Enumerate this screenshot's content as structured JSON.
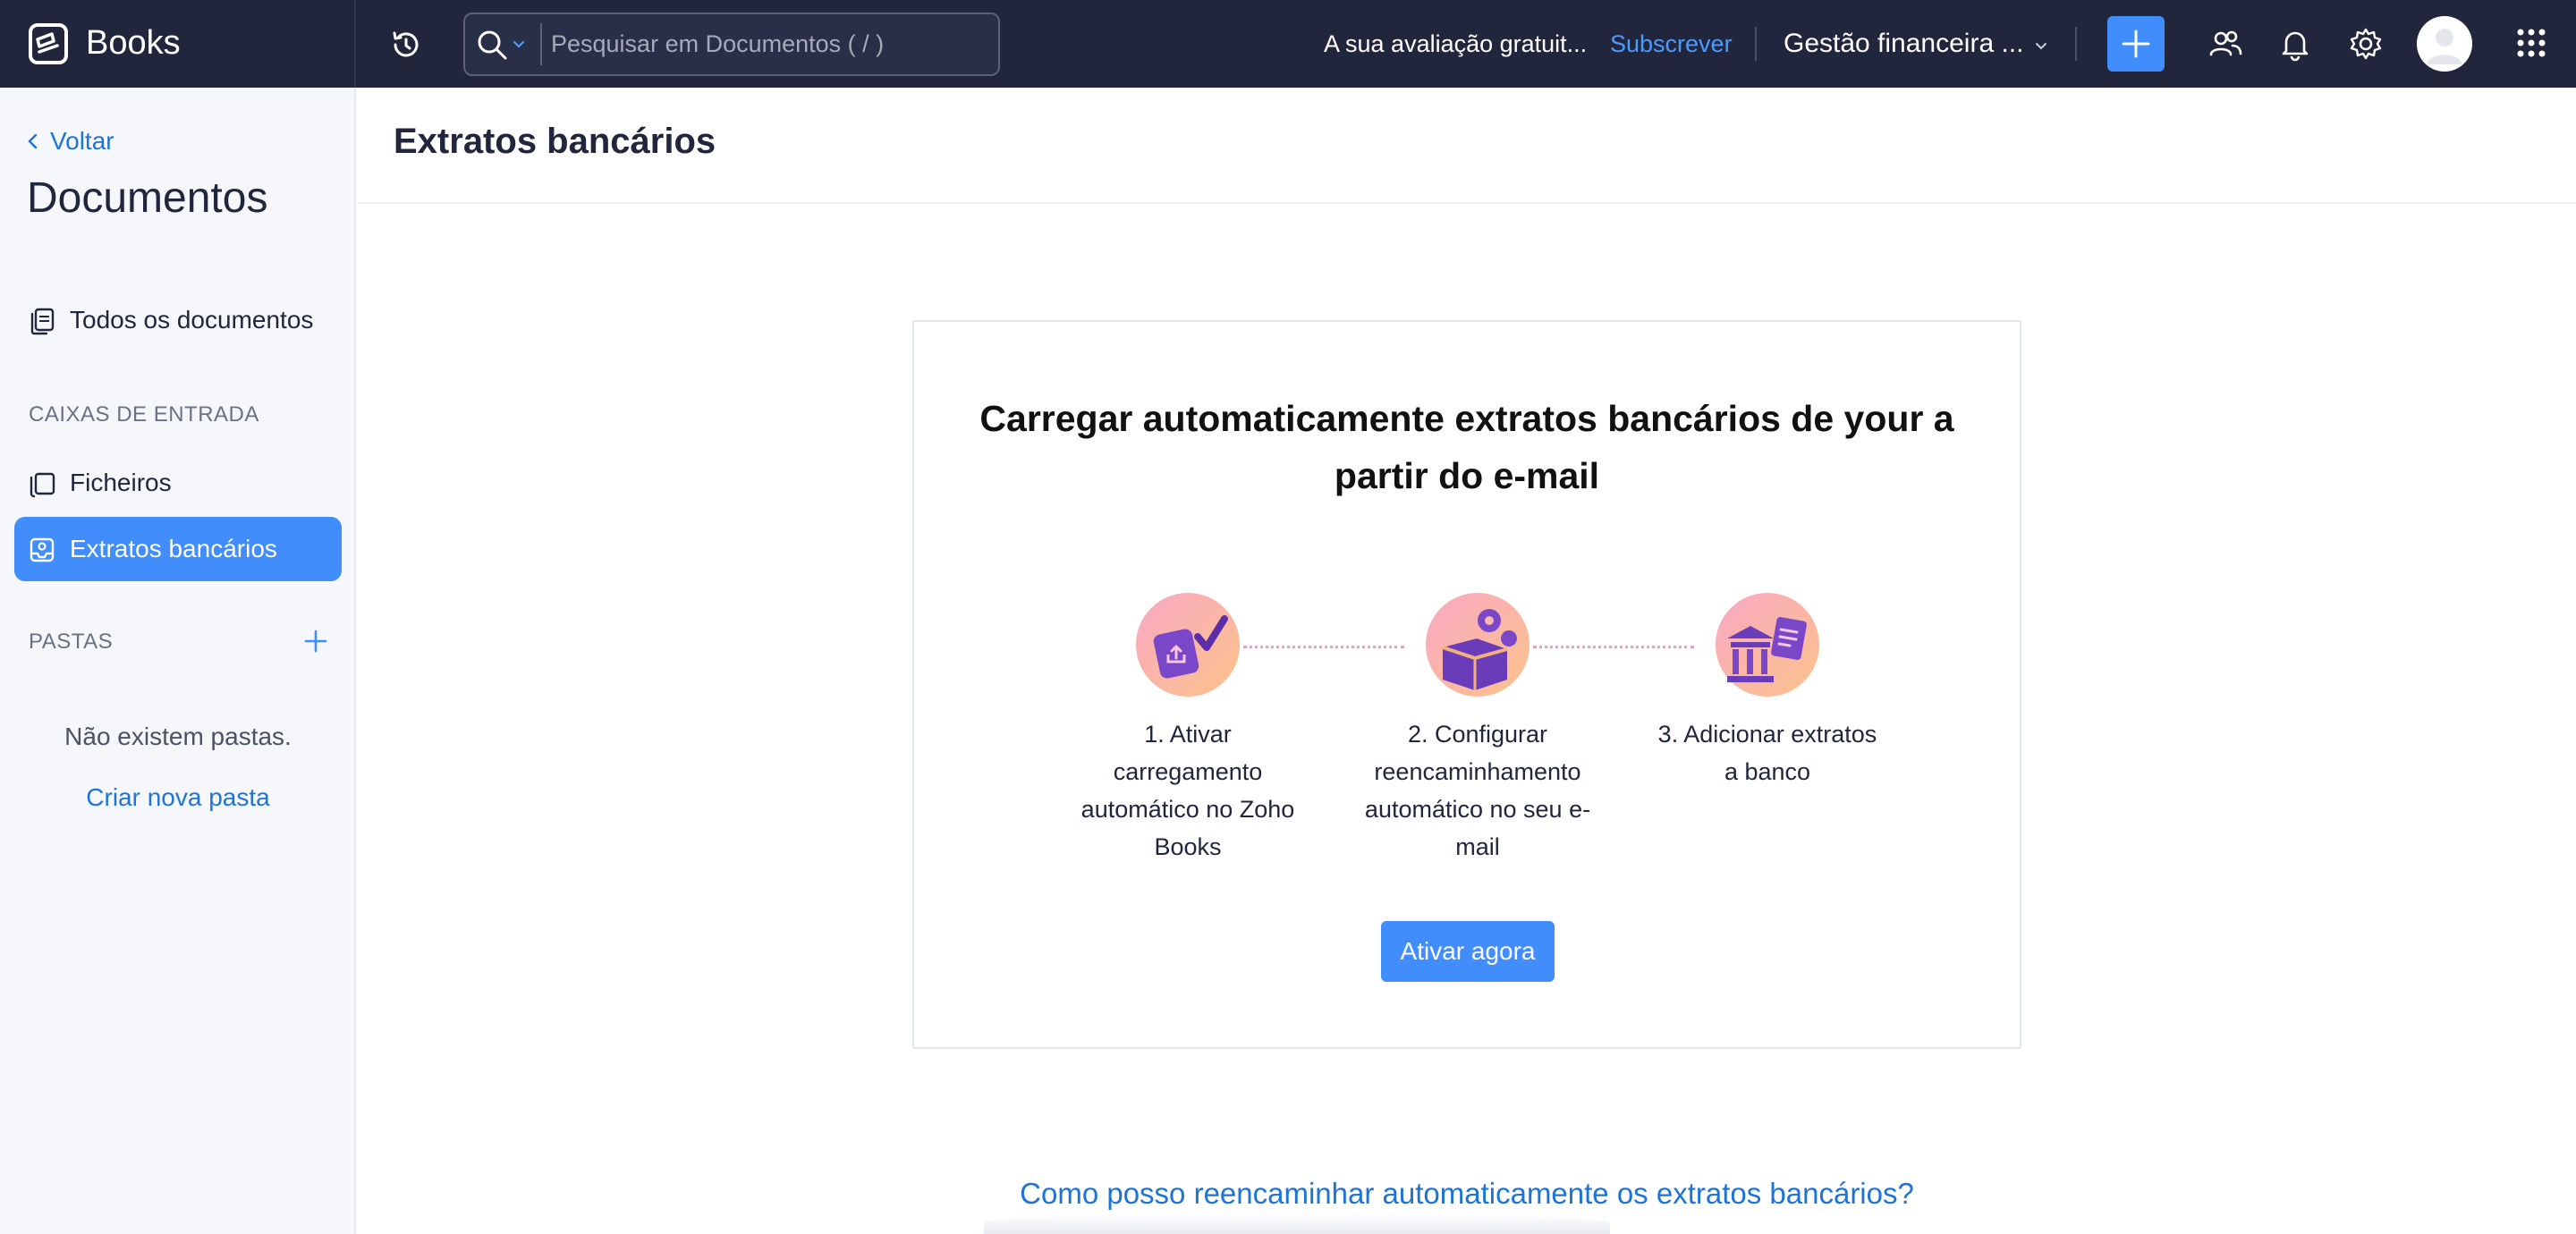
{
  "app": {
    "brand": "Books"
  },
  "topbar": {
    "search_placeholder": "Pesquisar em Documentos ( / )",
    "trial_text": "A sua avaliação gratuit...",
    "subscribe_label": "Subscrever",
    "org_name": "Gestão financeira ...",
    "accent": "#408dfb",
    "bg": "#21263c"
  },
  "sidebar": {
    "back_label": "Voltar",
    "title": "Documentos",
    "all_docs_label": "Todos os documentos",
    "inbox_section": "CAIXAS DE ENTRADA",
    "inbox_items": [
      {
        "label": "Ficheiros",
        "active": false
      },
      {
        "label": "Extratos bancários",
        "active": true
      }
    ],
    "folders_section": "PASTAS",
    "empty_folders": "Não existem pastas.",
    "create_folder": "Criar nova pasta"
  },
  "main": {
    "page_title": "Extratos bancários",
    "card_title": "Carregar automaticamente extratos bancários de your a partir do e-mail",
    "steps": [
      {
        "label": "1. Ativar carregamento automático no Zoho Books",
        "icon": "upload-check-icon"
      },
      {
        "label": "2. Configurar reencaminhamento automático no seu e-mail",
        "icon": "gear-box-icon"
      },
      {
        "label": "3. Adicionar extratos a banco",
        "icon": "bank-document-icon"
      }
    ],
    "activate_label": "Ativar agora",
    "help_link": "Como posso reencaminhar automaticamente os extratos bancários?"
  }
}
